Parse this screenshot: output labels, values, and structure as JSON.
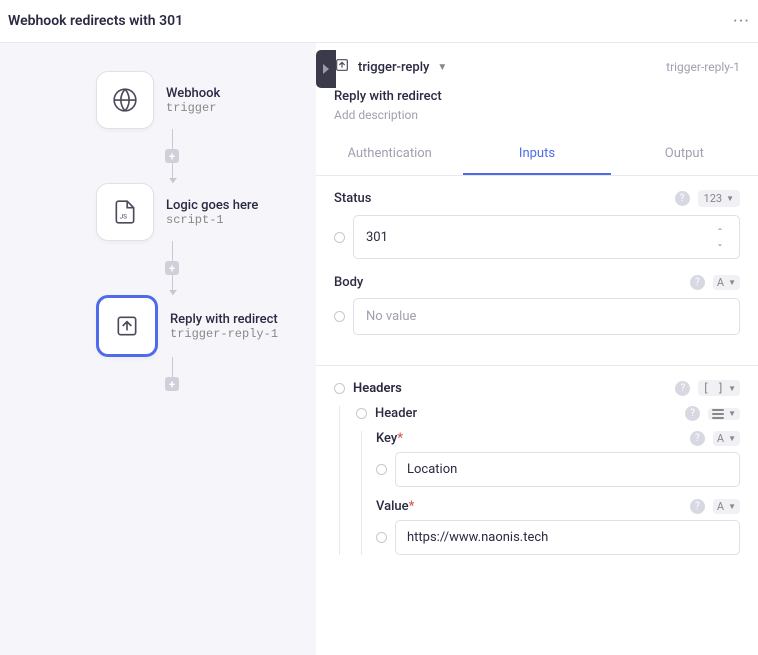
{
  "header": {
    "title": "Webhook redirects with 301"
  },
  "canvas": {
    "nodes": [
      {
        "title": "Webhook",
        "subtitle": "trigger"
      },
      {
        "title": "Logic goes here",
        "subtitle": "script-1"
      },
      {
        "title": "Reply with redirect",
        "subtitle": "trigger-reply-1"
      }
    ]
  },
  "panel": {
    "name": "trigger-reply",
    "id": "trigger-reply-1",
    "title": "Reply with redirect",
    "desc_placeholder": "Add description"
  },
  "tabs": {
    "auth": "Authentication",
    "inputs": "Inputs",
    "output": "Output"
  },
  "inputs": {
    "status": {
      "label": "Status",
      "value": "301",
      "type_badge": "123"
    },
    "body": {
      "label": "Body",
      "placeholder": "No value",
      "type_badge": "A"
    },
    "headers": {
      "label": "Headers",
      "type_badge": "[ ]",
      "header": {
        "label": "Header",
        "key": {
          "label": "Key",
          "value": "Location",
          "type_badge": "A"
        },
        "value": {
          "label": "Value",
          "value": "https://www.naonis.tech",
          "type_badge": "A"
        }
      }
    }
  }
}
